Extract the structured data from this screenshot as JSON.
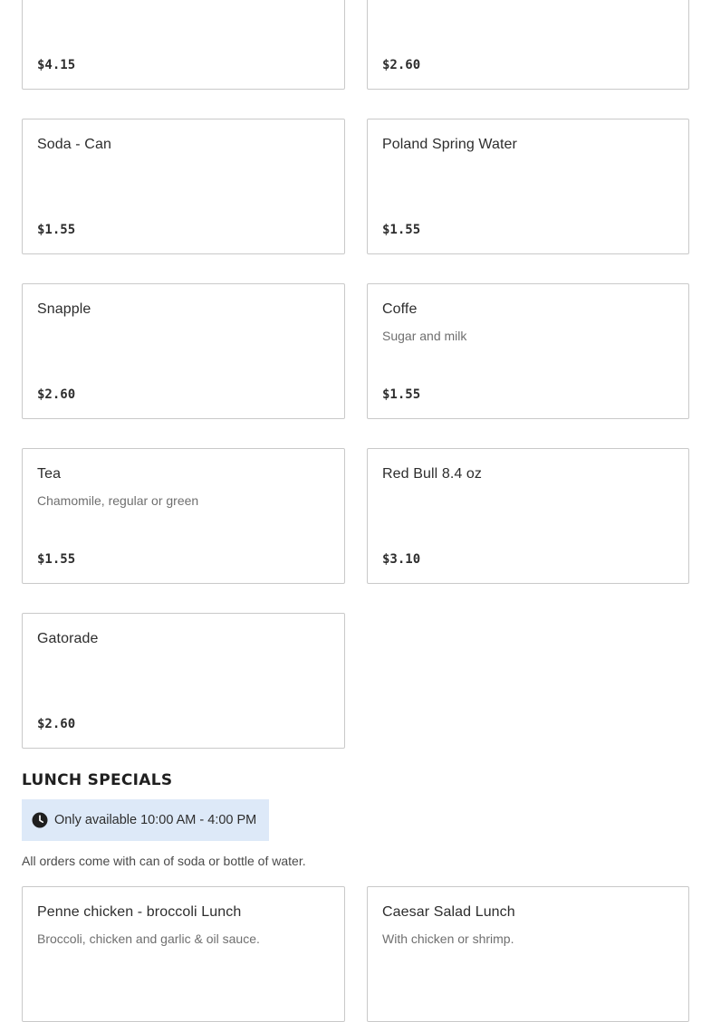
{
  "drinks": {
    "items": [
      {
        "name": "",
        "description": "",
        "price": "$4.15"
      },
      {
        "name": "",
        "description": "",
        "price": "$2.60"
      },
      {
        "name": "Soda - Can",
        "description": "",
        "price": "$1.55"
      },
      {
        "name": "Poland Spring Water",
        "description": "",
        "price": "$1.55"
      },
      {
        "name": "Snapple",
        "description": "",
        "price": "$2.60"
      },
      {
        "name": "Coffe",
        "description": "Sugar and milk",
        "price": "$1.55"
      },
      {
        "name": "Tea",
        "description": "Chamomile, regular or green",
        "price": "$1.55"
      },
      {
        "name": "Red Bull 8.4 oz",
        "description": "",
        "price": "$3.10"
      },
      {
        "name": "Gatorade",
        "description": "",
        "price": "$2.60"
      }
    ]
  },
  "lunch_specials": {
    "title": "LUNCH SPECIALS",
    "availability": "Only available 10:00 AM - 4:00 PM",
    "availability_icon": "clock-icon",
    "note": "All orders come with can of soda or bottle of water.",
    "items": [
      {
        "name": "Penne chicken - broccoli Lunch",
        "description": "Broccoli, chicken and garlic & oil sauce."
      },
      {
        "name": "Caesar Salad Lunch",
        "description": "With chicken or shrimp."
      }
    ]
  },
  "colors": {
    "card_border": "#c9c9c9",
    "availability_bg": "#dde9f8",
    "text_primary": "#2d2d2d",
    "text_secondary": "#6f6f6f"
  }
}
